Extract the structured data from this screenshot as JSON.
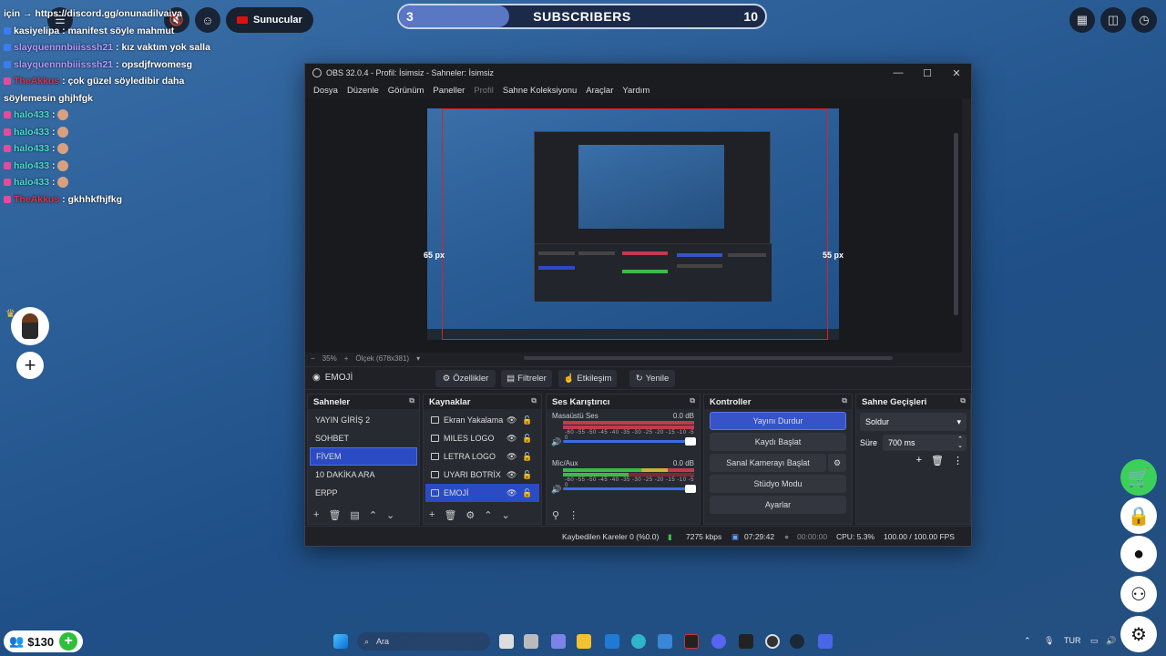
{
  "top_bar": {
    "sunucular_label": "Sunucular",
    "subscribers": {
      "label": "SUBSCRIBERS",
      "current": "3",
      "goal": "10",
      "progress": 0.3
    }
  },
  "chat": [
    {
      "user": "",
      "text": "için → https://discord.gg/onunadilvaiva",
      "cls": "u-kas"
    },
    {
      "user": "kasiyelipa",
      "text": ": manifest söyle mahmut",
      "cls": "u-kas"
    },
    {
      "user": "slayquennnbiiisssh21",
      "text": ": kız vaktım yok salla",
      "cls": "u-slay"
    },
    {
      "user": "slayquennnbiiisssh21",
      "text": ": opsdjfrwomesg",
      "cls": "u-slay"
    },
    {
      "user": "TheAkkus",
      "text": ": çok güzel söyledibir daha söylemesin ghjhfgk",
      "cls": "u-the"
    },
    {
      "user": "halo433",
      "text": ":",
      "cls": "u-halo",
      "emoji": true
    },
    {
      "user": "halo433",
      "text": ":",
      "cls": "u-halo",
      "emoji": true
    },
    {
      "user": "halo433",
      "text": ":",
      "cls": "u-halo",
      "emoji": true
    },
    {
      "user": "halo433",
      "text": ":",
      "cls": "u-halo",
      "emoji": true
    },
    {
      "user": "halo433",
      "text": ":",
      "cls": "u-halo",
      "emoji": true
    },
    {
      "user": "TheAkkus",
      "text": ": gkhhkfhjfkg",
      "cls": "u-the"
    }
  ],
  "money": {
    "amount": "$130"
  },
  "obs": {
    "title": "OBS 32.0.4 - Profil: İsimsiz - Sahneler: İsimsiz",
    "menu": [
      "Dosya",
      "Düzenle",
      "Görünüm",
      "Paneller",
      "Profil",
      "Sahne Koleksiyonu",
      "Araçlar",
      "Yardım"
    ],
    "preview": {
      "left_px": "65 px",
      "right_px": "55 px",
      "zoom": "35%",
      "scale": "Ölçek (678x381)"
    },
    "source_toolbar": {
      "selected": "EMOJİ",
      "buttons": [
        "Özellikler",
        "Filtreler",
        "Etkileşim",
        "Yenile"
      ]
    },
    "docks": {
      "scenes": {
        "title": "Sahneler",
        "items": [
          "YAYIN GİRİŞ 2",
          "SOHBET",
          "FİVEM",
          "10 DAKİKA ARA",
          "ERPP"
        ],
        "active": 2
      },
      "sources": {
        "title": "Kaynaklar",
        "items": [
          "Ekran Yakalama",
          "MILES LOGO",
          "LETRA LOGO",
          "UYARI BOTRİX",
          "EMOJİ"
        ],
        "active": 4
      },
      "mixer": {
        "title": "Ses Karıştırıcı",
        "tracks": [
          {
            "name": "Masaüstü Ses",
            "db": "0.0 dB"
          },
          {
            "name": "Mic/Aux",
            "db": "0.0 dB"
          }
        ],
        "scale": "-60 -55 -50 -45 -40 -35 -30 -25 -20 -15 -10 -5 0"
      },
      "controls": {
        "title": "Kontroller",
        "buttons": [
          "Yayını Durdur",
          "Kaydı Başlat",
          "Sanal Kamerayı Başlat",
          "Stüdyo Modu",
          "Ayarlar"
        ]
      },
      "transitions": {
        "title": "Sahne Geçişleri",
        "selected": "Soldur",
        "duration_label": "Süre",
        "duration": "700 ms"
      }
    },
    "status": {
      "dropped": "Kaybedilen Kareler 0 (%0.0)",
      "bitrate": "7275 kbps",
      "stream_time": "07:29:42",
      "rec_time": "00:00:00",
      "cpu": "CPU: 5.3%",
      "fps": "100.00 / 100.00 FPS"
    }
  },
  "taskbar": {
    "search_placeholder": "Ara",
    "lang": "TUR"
  },
  "colors": {
    "accent": "#3654c8",
    "meter_red": "#c23a4e",
    "meter_green": "#3dbb4a"
  }
}
